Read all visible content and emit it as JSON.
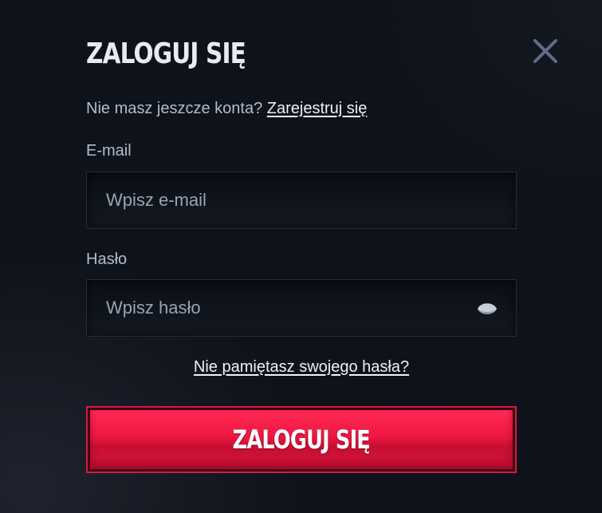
{
  "modal": {
    "title": "ZALOGUJ SIĘ",
    "signup_prompt": "Nie masz jeszcze konta?",
    "signup_link": "Zarejestruj się",
    "email": {
      "label": "E-mail",
      "placeholder": "Wpisz e-mail",
      "value": ""
    },
    "password": {
      "label": "Hasło",
      "placeholder": "Wpisz hasło",
      "value": ""
    },
    "forgot_link": "Nie pamiętasz swojego hasła?",
    "submit_label": "ZALOGUJ SIĘ",
    "icons": {
      "close": "close-icon",
      "show_password": "eye-icon"
    }
  },
  "colors": {
    "background": "#0e121a",
    "text_primary": "#e7ebf2",
    "text_secondary": "#b3bccb",
    "accent": "#ee1742"
  }
}
